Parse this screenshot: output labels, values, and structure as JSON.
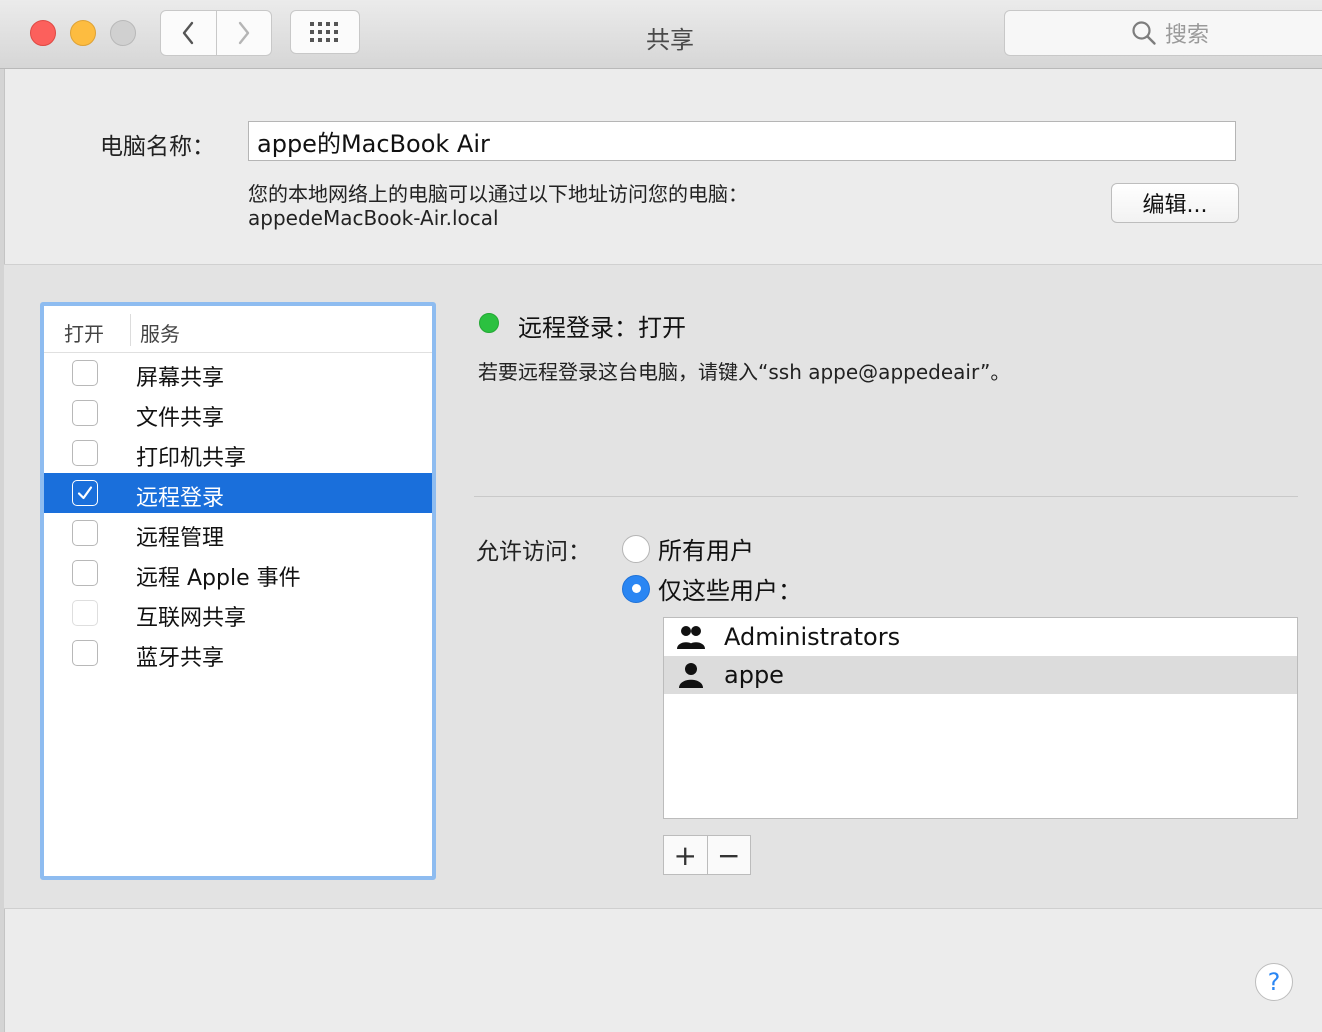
{
  "window": {
    "title": "共享",
    "search_placeholder": "搜索"
  },
  "computer": {
    "name_label": "电脑名称：",
    "name_value": "appe的MacBook Air",
    "address_desc": "您的本地网络上的电脑可以通过以下地址访问您的电脑：",
    "address_host": "appedeMacBook-Air.local",
    "edit_label": "编辑..."
  },
  "services": {
    "col_open": "打开",
    "col_service": "服务",
    "items": [
      {
        "label": "屏幕共享",
        "checked": false
      },
      {
        "label": "文件共享",
        "checked": false
      },
      {
        "label": "打印机共享",
        "checked": false
      },
      {
        "label": "远程登录",
        "checked": true,
        "selected": true
      },
      {
        "label": "远程管理",
        "checked": false
      },
      {
        "label": "远程 Apple 事件",
        "checked": false
      },
      {
        "label": "互联网共享",
        "checked": false,
        "disabled": true
      },
      {
        "label": "蓝牙共享",
        "checked": false
      }
    ]
  },
  "detail": {
    "status_text": "远程登录：打开",
    "status_color": "#2bc140",
    "hint": "若要远程登录这台电脑，请键入“ssh appe@appedeair”。",
    "access_label": "允许访问：",
    "radio_all": "所有用户",
    "radio_some": "仅这些用户：",
    "users": [
      {
        "name": "Administrators",
        "icon": "group-icon"
      },
      {
        "name": "appe",
        "icon": "user-icon",
        "selected": true
      }
    ],
    "add_label": "+",
    "remove_label": "−"
  },
  "help_label": "?"
}
